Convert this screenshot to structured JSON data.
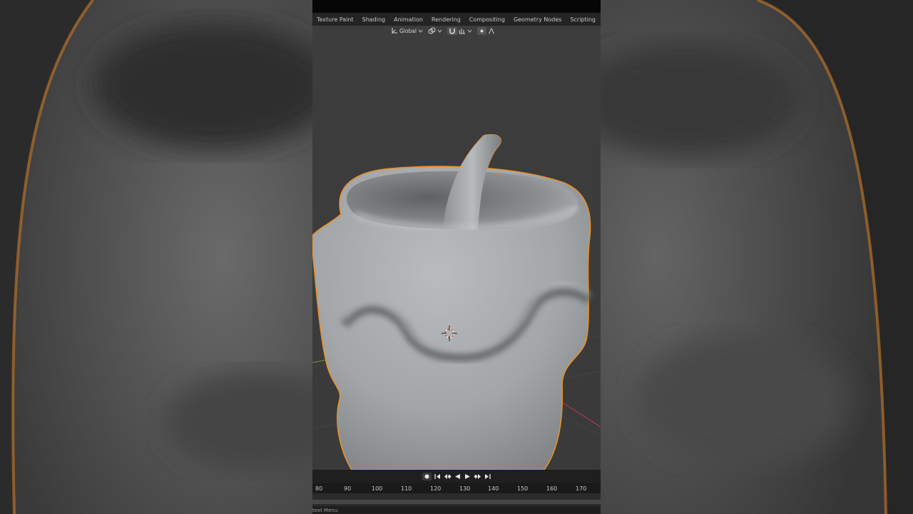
{
  "workspace_tabs": [
    "Texture Paint",
    "Shading",
    "Animation",
    "Rendering",
    "Compositing",
    "Geometry Nodes",
    "Scripting"
  ],
  "add_tab_label": "+",
  "header": {
    "orientation_label": "Global",
    "orientation_icon": "transform-axes-icon",
    "pivot_icon": "pivot-point-icon",
    "snap_icon": "snap-magnet-icon",
    "snap_increment_icon": "snap-increment-icon",
    "proportional_icon": "proportional-edit-icon",
    "falloff_icon": "falloff-curve-icon"
  },
  "timeline": {
    "frame_labels": [
      "80",
      "90",
      "100",
      "110",
      "120",
      "130",
      "140",
      "150",
      "160",
      "170"
    ],
    "controls": [
      "record-icon",
      "jump-start-icon",
      "prev-keyframe-icon",
      "play-reverse-icon",
      "play-icon",
      "next-keyframe-icon",
      "jump-end-icon"
    ]
  },
  "status_bar": {
    "text": "text Menu"
  },
  "colors": {
    "selection_outline": "#e8902a",
    "viewport_bg": "#3b3b3b",
    "x_axis": "#c0394b",
    "y_axis": "#6a9a2a"
  }
}
